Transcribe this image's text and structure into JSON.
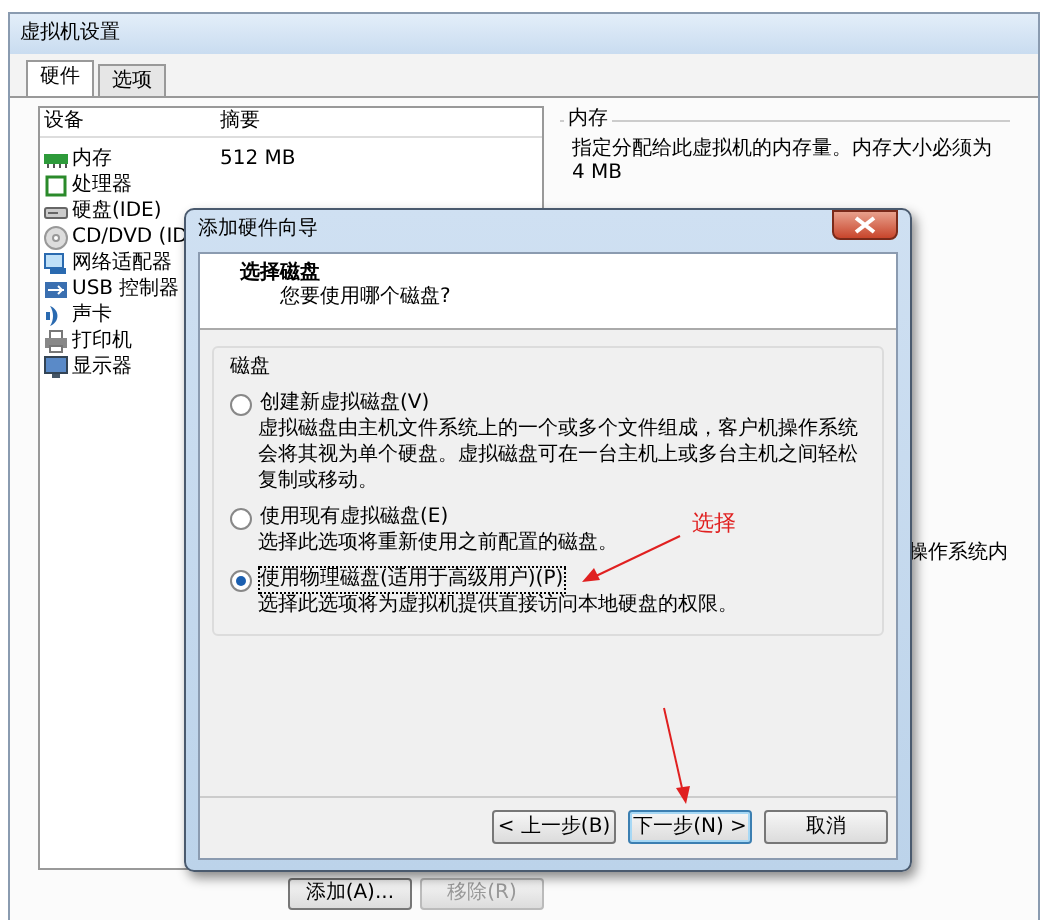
{
  "window": {
    "title": "虚拟机设置"
  },
  "tabs": [
    {
      "label": "硬件",
      "selected": true
    },
    {
      "label": "选项",
      "selected": false
    }
  ],
  "device_list": {
    "columns": [
      "设备",
      "摘要"
    ],
    "rows": [
      {
        "kind": "memory",
        "device": "内存",
        "summary": "512 MB"
      },
      {
        "kind": "cpu",
        "device": "处理器"
      },
      {
        "kind": "disk",
        "device": "硬盘(IDE)"
      },
      {
        "kind": "cd",
        "device": "CD/DVD (ID"
      },
      {
        "kind": "network",
        "device": "网络适配器"
      },
      {
        "kind": "usb",
        "device": "USB 控制器"
      },
      {
        "kind": "sound",
        "device": "声卡"
      },
      {
        "kind": "printer",
        "device": "打印机"
      },
      {
        "kind": "display",
        "device": "显示器"
      }
    ]
  },
  "list_buttons": [
    {
      "label": "添加(A)...",
      "disabled": false
    },
    {
      "label": "移除(R)",
      "disabled": true
    }
  ],
  "memory_panel": {
    "title": "内存",
    "description": "指定分配给此虚拟机的内存量。内存大小必须为 4 MB",
    "fragment": "操作系统内"
  },
  "dialog": {
    "title": "添加硬件向导",
    "heading": "选择磁盘",
    "subheading": "您要使用哪个磁盘?",
    "group_title": "磁盘",
    "options": [
      {
        "label": "创建新虚拟磁盘(V)",
        "description": "虚拟磁盘由主机文件系统上的一个或多个文件组成，客户机操作系统会将其视为单个硬盘。虚拟磁盘可在一台主机上或多台主机之间轻松复制或移动。",
        "selected": false
      },
      {
        "label": "使用现有虚拟磁盘(E)",
        "description": "选择此选项将重新使用之前配置的磁盘。",
        "selected": false
      },
      {
        "label": "使用物理磁盘(适用于高级用户)(P)",
        "description": "选择此选项将为虚拟机提供直接访问本地硬盘的权限。",
        "selected": true
      }
    ],
    "buttons": [
      {
        "label": "< 上一步(B)",
        "default": false
      },
      {
        "label": "下一步(N) >",
        "default": true
      },
      {
        "label": "取消",
        "default": false
      }
    ]
  },
  "annotation": {
    "label": "选择"
  }
}
